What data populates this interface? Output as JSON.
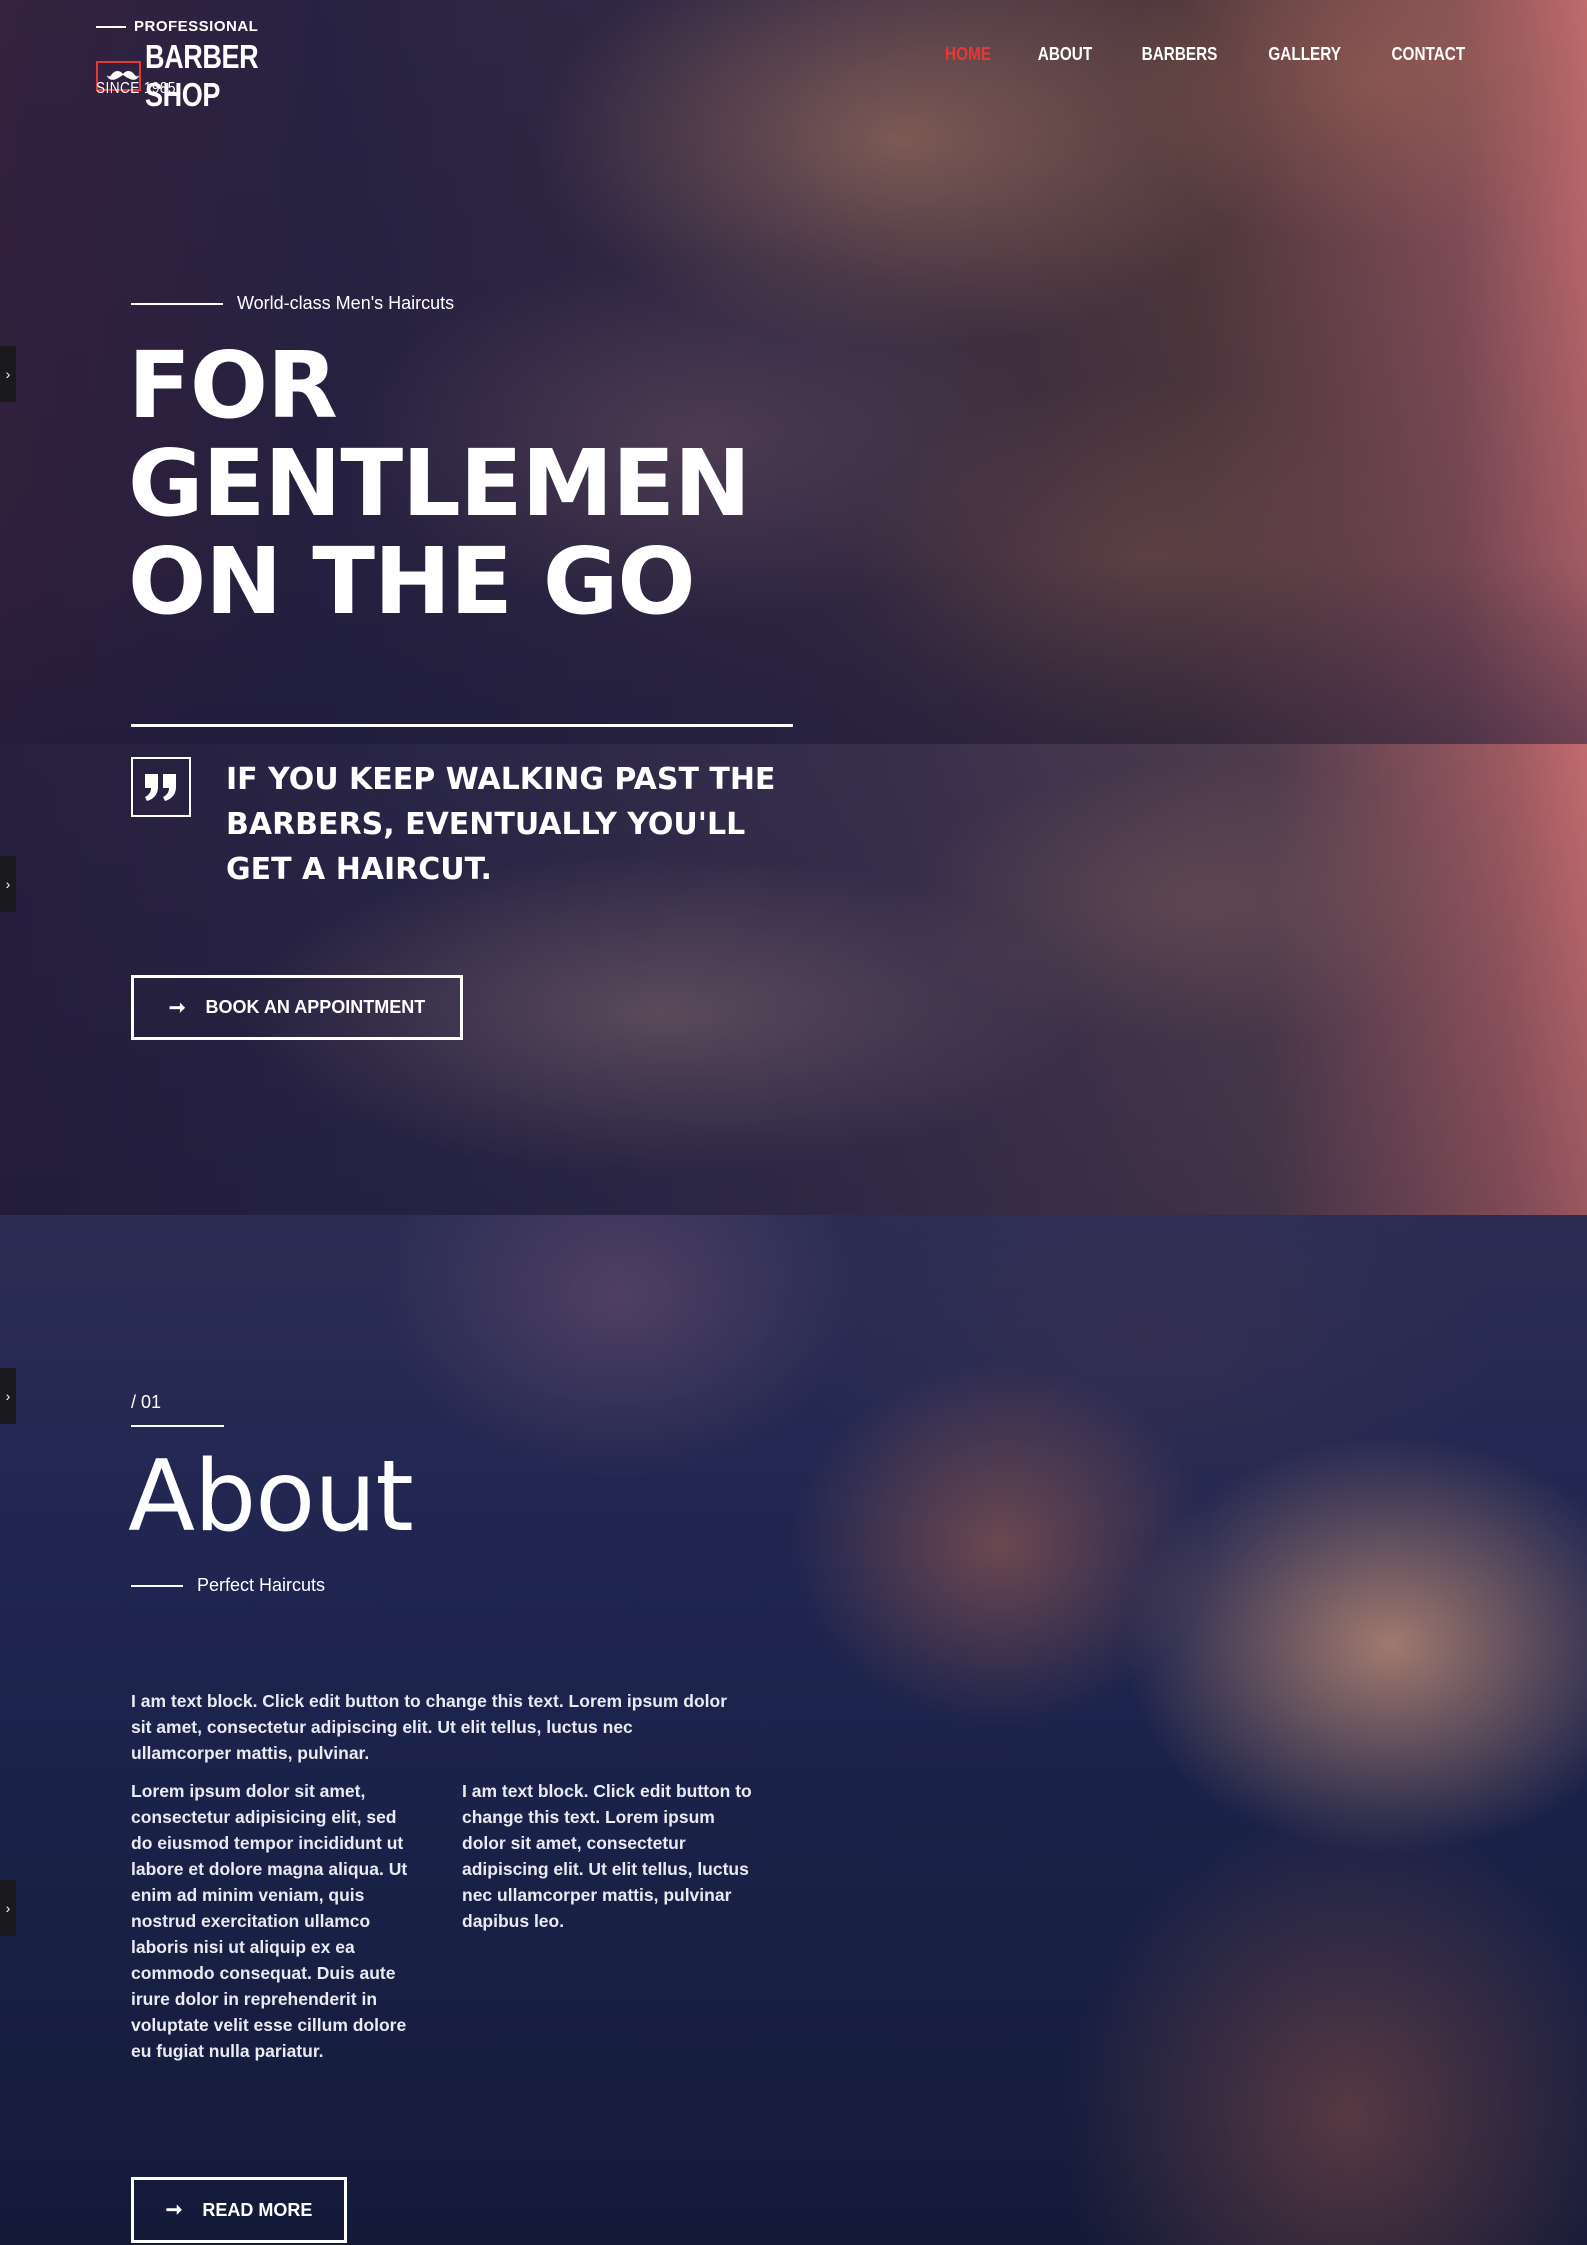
{
  "brand": {
    "tagline_top": "PROFESSIONAL",
    "name": "BARBER SHOP",
    "since": "SINCE 1985",
    "accent_color": "#e53935",
    "logo_icon": "mustache-icon"
  },
  "nav": {
    "items": [
      {
        "label": "HOME",
        "active": true
      },
      {
        "label": "ABOUT",
        "active": false
      },
      {
        "label": "BARBERS",
        "active": false
      },
      {
        "label": "GALLERY",
        "active": false
      },
      {
        "label": "CONTACT",
        "active": false
      }
    ]
  },
  "hero": {
    "eyebrow": "World-class Men's Haircuts",
    "title_lines": [
      "FOR",
      "GENTLEMEN",
      "ON THE GO"
    ],
    "quote_icon": "quote-icon",
    "quote_text": "IF YOU KEEP WALKING PAST THE BARBERS, EVENTUALLY YOU'LL GET A HAIRCUT.",
    "cta_icon": "arrow-right-icon",
    "cta_label": "BOOK AN APPOINTMENT"
  },
  "about": {
    "section_number": "/ 01",
    "title": "About",
    "subtitle": "Perfect Haircuts",
    "paragraph": "I am text block. Click edit button to change this text. Lorem ipsum dolor sit amet, consectetur adipiscing elit. Ut elit tellus, luctus nec ullamcorper mattis, pulvinar.",
    "column_left": "Lorem ipsum dolor sit amet, consectetur adipisicing elit, sed do eiusmod tempor incididunt ut labore et dolore magna aliqua. Ut enim ad minim veniam, quis nostrud exercitation ullamco laboris nisi ut aliquip ex ea commodo consequat. Duis aute irure dolor in reprehenderit in voluptate velit esse cillum dolore eu fugiat nulla pariatur.",
    "column_right": "I am text block. Click edit button to change this text. Lorem ipsum dolor sit amet, consectetur adipiscing elit. Ut elit tellus, luctus nec ullamcorper mattis, pulvinar dapibus leo.",
    "cta_icon": "arrow-right-icon",
    "cta_label": "READ MORE"
  },
  "side_tabs": {
    "icon": "chevron-right-icon",
    "glyph": "›"
  }
}
